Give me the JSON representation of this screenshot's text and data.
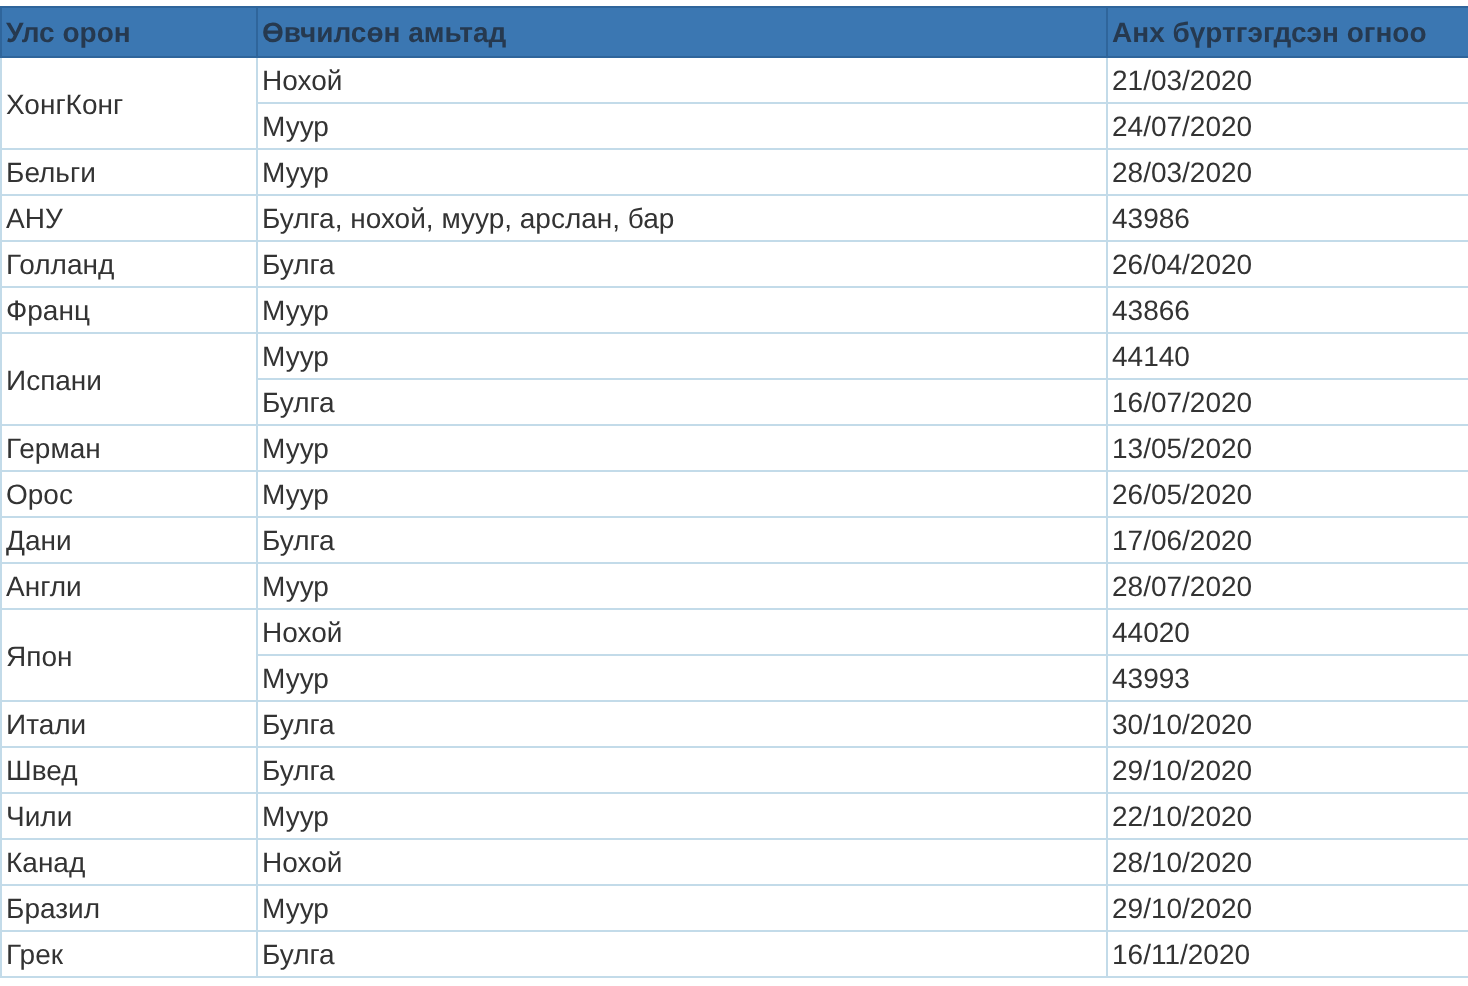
{
  "table": {
    "columns": [
      "Улс орон",
      "Өвчилсөн амьтад",
      "Анх бүртгэгдсэн огноо"
    ],
    "groups": [
      {
        "country": "ХонгКонг",
        "entries": [
          {
            "animal": "Нохой",
            "date": "21/03/2020"
          },
          {
            "animal": "Муур",
            "date": "24/07/2020"
          }
        ]
      },
      {
        "country": "Бельги",
        "entries": [
          {
            "animal": "Муур",
            "date": "28/03/2020"
          }
        ]
      },
      {
        "country": "АНУ",
        "entries": [
          {
            "animal": "Булга, нохой, муур, арслан, бар",
            "date": "43986"
          }
        ]
      },
      {
        "country": "Голланд",
        "entries": [
          {
            "animal": "Булга",
            "date": "26/04/2020"
          }
        ]
      },
      {
        "country": "Франц",
        "entries": [
          {
            "animal": "Муур",
            "date": "43866"
          }
        ]
      },
      {
        "country": "Испани",
        "entries": [
          {
            "animal": "Муур",
            "date": "44140"
          },
          {
            "animal": "Булга",
            "date": "16/07/2020"
          }
        ]
      },
      {
        "country": "Герман",
        "entries": [
          {
            "animal": "Муур",
            "date": "13/05/2020"
          }
        ]
      },
      {
        "country": "Орос",
        "entries": [
          {
            "animal": "Муур",
            "date": "26/05/2020"
          }
        ]
      },
      {
        "country": "Дани",
        "entries": [
          {
            "animal": "Булга",
            "date": "17/06/2020"
          }
        ]
      },
      {
        "country": "Англи",
        "entries": [
          {
            "animal": "Муур",
            "date": "28/07/2020"
          }
        ]
      },
      {
        "country": "Япон",
        "entries": [
          {
            "animal": "Нохой",
            "date": "44020"
          },
          {
            "animal": "Муур",
            "date": "43993"
          }
        ]
      },
      {
        "country": "Итали",
        "entries": [
          {
            "animal": "Булга",
            "date": "30/10/2020"
          }
        ]
      },
      {
        "country": "Швед",
        "entries": [
          {
            "animal": "Булга",
            "date": "29/10/2020"
          }
        ]
      },
      {
        "country": "Чили",
        "entries": [
          {
            "animal": "Муур",
            "date": "22/10/2020"
          }
        ]
      },
      {
        "country": "Канад",
        "entries": [
          {
            "animal": "Нохой",
            "date": "28/10/2020"
          }
        ]
      },
      {
        "country": "Бразил",
        "entries": [
          {
            "animal": "Муур",
            "date": "29/10/2020"
          }
        ]
      },
      {
        "country": "Грек",
        "entries": [
          {
            "animal": "Булга",
            "date": "16/11/2020"
          }
        ]
      }
    ]
  }
}
